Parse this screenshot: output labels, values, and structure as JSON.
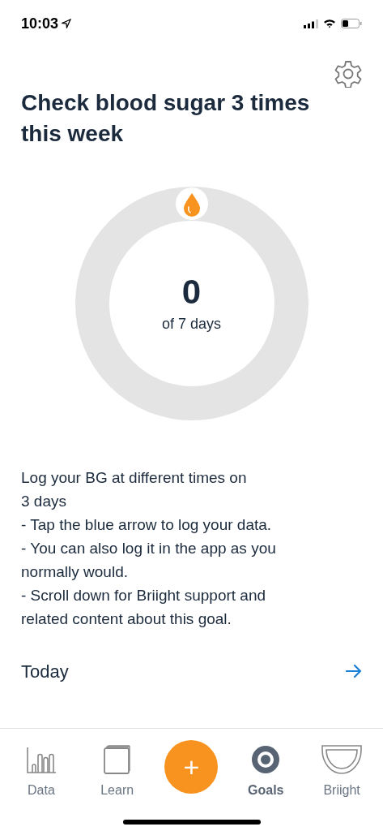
{
  "status_bar": {
    "time": "10:03"
  },
  "goal": {
    "title": "Check blood sugar 3 times this week",
    "count": "0",
    "count_label": "of 7 days"
  },
  "description": "Log your BG at different times on\n3 days\n- Tap the blue arrow to log your data.\n- You can also log it in the app as you\nnormally would.\n- Scroll down for Briight support and\nrelated content about this goal.",
  "today": {
    "label": "Today"
  },
  "tab_bar": [
    {
      "kind": "data",
      "label": "Data",
      "selected": false
    },
    {
      "kind": "learn",
      "label": "Learn",
      "selected": false
    },
    {
      "kind": "add",
      "label": "+",
      "selected": false
    },
    {
      "kind": "goals",
      "label": "Goals",
      "selected": true
    },
    {
      "kind": "briight",
      "label": "Briight",
      "selected": false
    }
  ]
}
